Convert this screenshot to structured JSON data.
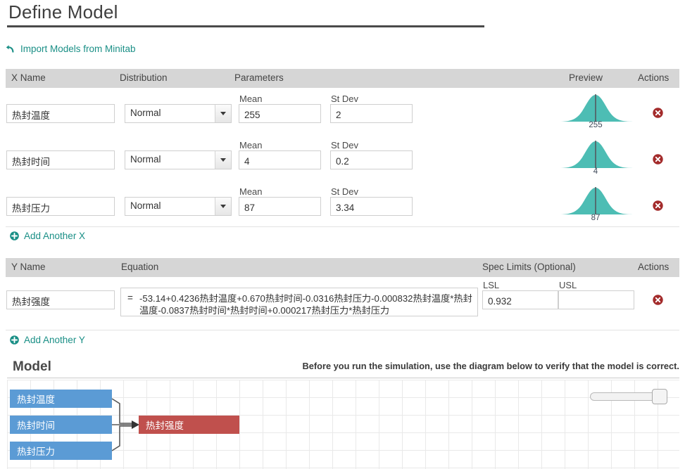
{
  "page": {
    "title": "Define Model"
  },
  "import_link": {
    "label": "Import Models from Minitab",
    "icon": "import-arrow-icon"
  },
  "x_table": {
    "headers": {
      "name": "X Name",
      "distribution": "Distribution",
      "parameters": "Parameters",
      "preview": "Preview",
      "actions": "Actions"
    },
    "param_labels": {
      "mean": "Mean",
      "stdev": "St Dev"
    },
    "rows": [
      {
        "name": "热封温度",
        "distribution": "Normal",
        "mean": "255",
        "stdev": "2",
        "preview_value": "255"
      },
      {
        "name": "热封时间",
        "distribution": "Normal",
        "mean": "4",
        "stdev": "0.2",
        "preview_value": "4"
      },
      {
        "name": "热封压力",
        "distribution": "Normal",
        "mean": "87",
        "stdev": "3.34",
        "preview_value": "87"
      }
    ],
    "add_label": "Add Another X"
  },
  "y_table": {
    "headers": {
      "name": "Y Name",
      "equation": "Equation",
      "spec_limits": "Spec Limits (Optional)",
      "actions": "Actions"
    },
    "spec_labels": {
      "lsl": "LSL",
      "usl": "USL"
    },
    "rows": [
      {
        "name": "热封强度",
        "equals_sign": "=",
        "equation": "-53.14+0.4236热封温度+0.670热封时间-0.0316热封压力-0.000832热封温度*热封温度-0.0837热封时间*热封时间+0.000217热封压力*热封压力",
        "lsl": "0.932",
        "usl": ""
      }
    ],
    "add_label": "Add Another Y"
  },
  "model": {
    "heading": "Model",
    "note": "Before you run the simulation, use the diagram below to verify that the model is correct.",
    "diagram": {
      "inputs": [
        "热封温度",
        "热封时间",
        "热封压力"
      ],
      "output": "热封强度"
    }
  },
  "colors": {
    "accent_teal": "#1a8f86",
    "curve_teal": "#4dbdb4",
    "delete_red": "#a32b2b",
    "node_input_blue": "#5b9bd5",
    "node_output_red": "#c0504d",
    "header_gray": "#d6d6d6"
  }
}
